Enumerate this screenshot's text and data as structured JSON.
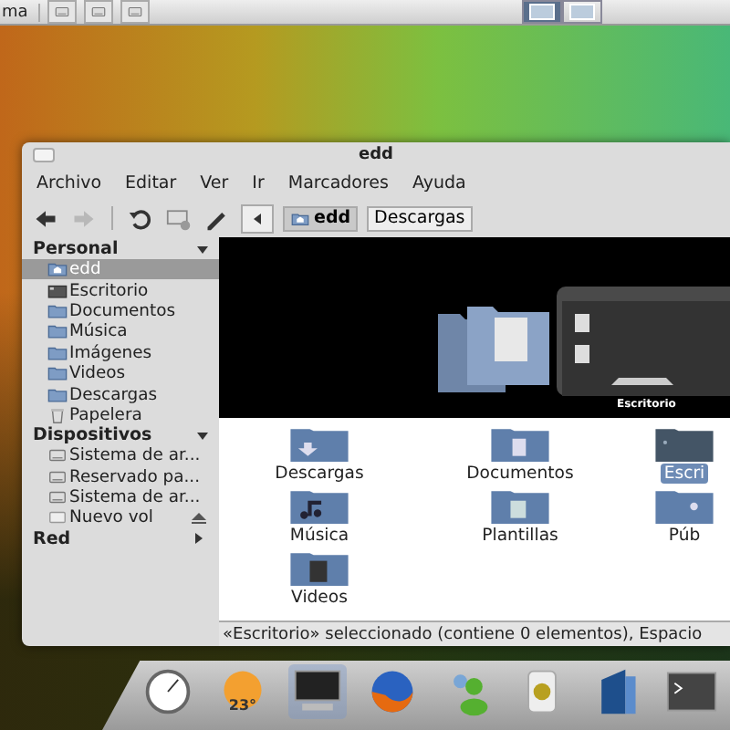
{
  "top_panel": {
    "label": "ma",
    "launchers": [
      {
        "kind": "drive"
      },
      {
        "kind": "drive"
      },
      {
        "kind": "drive"
      }
    ],
    "view_toggles": [
      {
        "selected": true
      },
      {
        "selected": false
      }
    ]
  },
  "window": {
    "title": "edd",
    "menu": [
      "Archivo",
      "Editar",
      "Ver",
      "Ir",
      "Marcadores",
      "Ayuda"
    ],
    "toolbar": [
      {
        "kind": "back",
        "disabled": false
      },
      {
        "kind": "forward",
        "disabled": true
      },
      {
        "kind": "reload",
        "disabled": false
      },
      {
        "kind": "computer",
        "disabled": false
      },
      {
        "kind": "edit",
        "disabled": false
      }
    ],
    "path": [
      {
        "label": "edd",
        "selected": true
      },
      {
        "label": "Descargas",
        "selected": false
      }
    ],
    "sidebar": [
      {
        "label": "Personal",
        "expanded": true,
        "items": [
          {
            "label": "edd",
            "kind": "home",
            "selected": true
          },
          {
            "label": "Escritorio",
            "kind": "desktop",
            "selected": false
          },
          {
            "label": "Documentos",
            "kind": "folder",
            "selected": false
          },
          {
            "label": "Música",
            "kind": "folder",
            "selected": false
          },
          {
            "label": "Imágenes",
            "kind": "folder",
            "selected": false
          },
          {
            "label": "Videos",
            "kind": "folder",
            "selected": false
          },
          {
            "label": "Descargas",
            "kind": "folder",
            "selected": false
          },
          {
            "label": "Papelera",
            "kind": "trash",
            "selected": false
          }
        ]
      },
      {
        "label": "Dispositivos",
        "expanded": true,
        "items": [
          {
            "label": "Sistema de ar...",
            "kind": "drive",
            "selected": false
          },
          {
            "label": "Reservado pa...",
            "kind": "drive",
            "selected": false
          },
          {
            "label": "Sistema de ar...",
            "kind": "drive",
            "selected": false
          },
          {
            "label": "Nuevo vol",
            "kind": "removable",
            "selected": false
          }
        ]
      },
      {
        "label": "Red",
        "expanded": false
      }
    ],
    "coverflow": {
      "caption": "Escritorio"
    },
    "files": [
      {
        "label": "Descargas",
        "kind": "download",
        "selected": false
      },
      {
        "label": "Documentos",
        "kind": "docs",
        "selected": false
      },
      {
        "label": "Escri",
        "kind": "desktop",
        "selected": true
      },
      {
        "label": "Música",
        "kind": "music",
        "selected": false
      },
      {
        "label": "Plantillas",
        "kind": "templates",
        "selected": false
      },
      {
        "label": "Púb",
        "kind": "public",
        "selected": false
      },
      {
        "label": "Videos",
        "kind": "video",
        "selected": false
      }
    ],
    "status_bar": "«Escritorio» seleccionado (contiene 0 elementos), Espacio"
  },
  "dock": [
    {
      "kind": "clock"
    },
    {
      "kind": "weather",
      "label": "23°"
    },
    {
      "kind": "monitor",
      "selected": true
    },
    {
      "kind": "browser"
    },
    {
      "kind": "chat"
    },
    {
      "kind": "speaker"
    },
    {
      "kind": "office"
    },
    {
      "kind": "terminal"
    }
  ]
}
